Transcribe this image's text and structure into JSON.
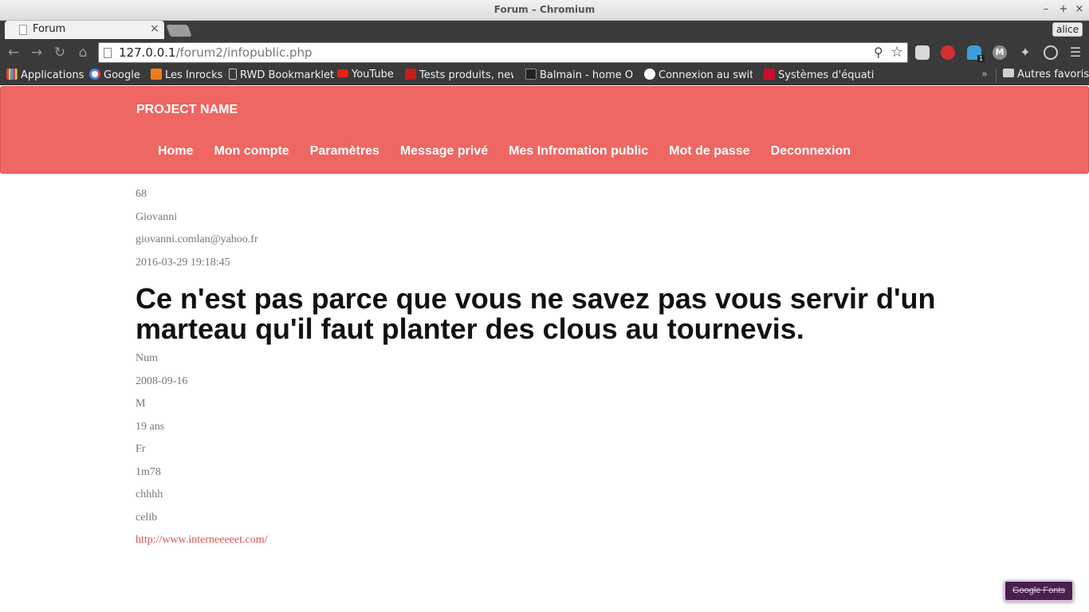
{
  "window": {
    "title": "Forum – Chromium",
    "min_glyph": "–",
    "max_glyph": "+",
    "close_glyph": "×"
  },
  "tabs": [
    {
      "title": "Forum",
      "close_glyph": "×"
    }
  ],
  "profile": {
    "name": "alice"
  },
  "toolbar": {
    "url_host": "127.0.0.1",
    "url_path": "/forum2/infopublic.php",
    "extension_badge": "1",
    "ext_m_label": "M"
  },
  "bookmarks": {
    "items": [
      {
        "label": "Applications",
        "icon": "apps-icon"
      },
      {
        "label": "Google",
        "icon": "google-icon"
      },
      {
        "label": "Les Inrocks",
        "icon": "inrocks-icon"
      },
      {
        "label": "RWD Bookmarklet",
        "icon": "page-icon"
      },
      {
        "label": "YouTube",
        "icon": "youtube-icon"
      },
      {
        "label": "Tests produits, new",
        "icon": "tests-icon"
      },
      {
        "label": "Balmain - home On",
        "icon": "balmain-icon"
      },
      {
        "label": "Connexion au switc",
        "icon": "connexion-icon"
      },
      {
        "label": "Systèmes d'équatio",
        "icon": "free-icon"
      }
    ],
    "more": "»",
    "other": "Autres favoris"
  },
  "site": {
    "brand": "PROJECT NAME",
    "nav": [
      "Home",
      "Mon compte",
      "Paramètres",
      "Message privé",
      "Mes Infromation public",
      "Mot de passe",
      "Deconnexion"
    ],
    "accent_color": "#ee6762"
  },
  "profile_info": {
    "id": "68",
    "name": "Giovanni",
    "email": "giovanni.comlan@yahoo.fr",
    "registered": "2016-03-29 19:18:45",
    "quote": "Ce n'est pas parce que vous ne savez pas vous servir d'un marteau qu'il faut planter des clous au tournevis.",
    "num": "Num",
    "birthdate": "2008-09-16",
    "sex": "M",
    "age": "19 ans",
    "country": "Fr",
    "height": "1m78",
    "hobby": "chhhh",
    "status": "celib",
    "website": "http://www.interneeeeet.com/"
  },
  "floating": {
    "label": "Google Fonts"
  }
}
